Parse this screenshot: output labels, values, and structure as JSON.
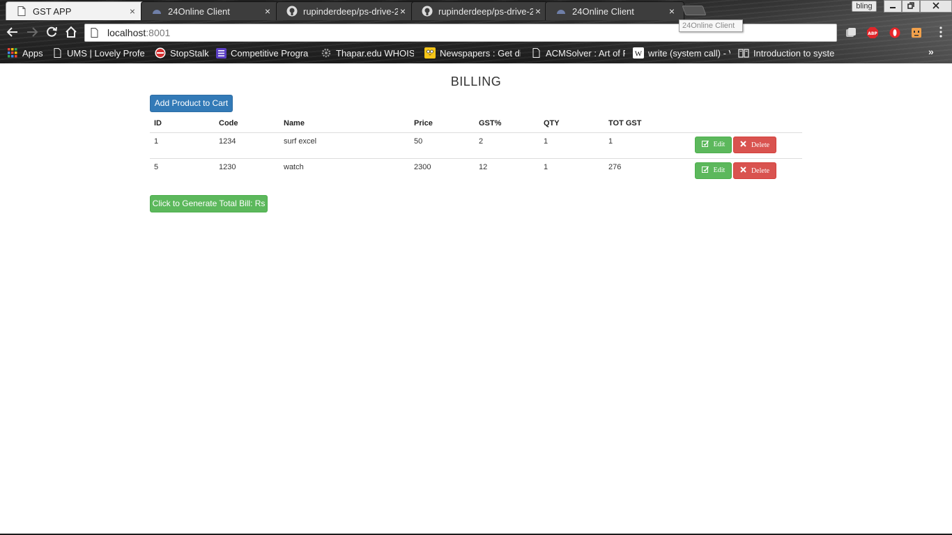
{
  "browser": {
    "tabs": [
      {
        "title": "GST APP",
        "icon": "document-icon",
        "active": true
      },
      {
        "title": "24Online Client",
        "icon": "cloud-icon",
        "active": false
      },
      {
        "title": "rupinderdeep/ps-drive-2",
        "icon": "github-icon",
        "active": false
      },
      {
        "title": "rupinderdeep/ps-drive-2",
        "icon": "github-icon",
        "active": false
      },
      {
        "title": "24Online Client",
        "icon": "cloud-icon",
        "active": false
      }
    ],
    "tab_close_glyph": "×",
    "profile_label": "bling",
    "tooltip": "24Online Client",
    "address": {
      "host": "localhost",
      "port": ":8001"
    },
    "bookmarks": [
      {
        "label": "Apps",
        "icon": "apps-grid-icon"
      },
      {
        "label": "UMS | Lovely Profess",
        "icon": "document-icon"
      },
      {
        "label": "StopStalk",
        "icon": "stopstalk-icon"
      },
      {
        "label": "Competitive Program",
        "icon": "list-icon"
      },
      {
        "label": "Thapar.edu WHOIS, I",
        "icon": "gear-icon"
      },
      {
        "label": "Newspapers : Get dig",
        "icon": "owl-icon"
      },
      {
        "label": "ACMSolver : Art of Pr",
        "icon": "document-icon"
      },
      {
        "label": "write (system call) - V",
        "icon": "wikipedia-icon"
      },
      {
        "label": "Introduction to syste",
        "icon": "book-icon"
      }
    ],
    "bookmarks_overflow": "»"
  },
  "page": {
    "title": "BILLING",
    "add_button": "Add Product to Cart",
    "generate_button": "Click to Generate Total Bill: Rs",
    "table": {
      "headers": [
        "ID",
        "Code",
        "Name",
        "Price",
        "GST%",
        "QTY",
        "TOT GST",
        ""
      ],
      "rows": [
        {
          "id": "1",
          "code": "1234",
          "name": "surf excel",
          "price": "50",
          "gst": "2",
          "qty": "1",
          "tot_gst": "1"
        },
        {
          "id": "5",
          "code": "1230",
          "name": "watch",
          "price": "2300",
          "gst": "12",
          "qty": "1",
          "tot_gst": "276"
        }
      ],
      "edit_label": "Edit",
      "delete_label": "Delete"
    }
  },
  "colors": {
    "primary": "#337ab7",
    "success": "#5cb85c",
    "danger": "#d9534f",
    "qty_text": "#a94442"
  }
}
